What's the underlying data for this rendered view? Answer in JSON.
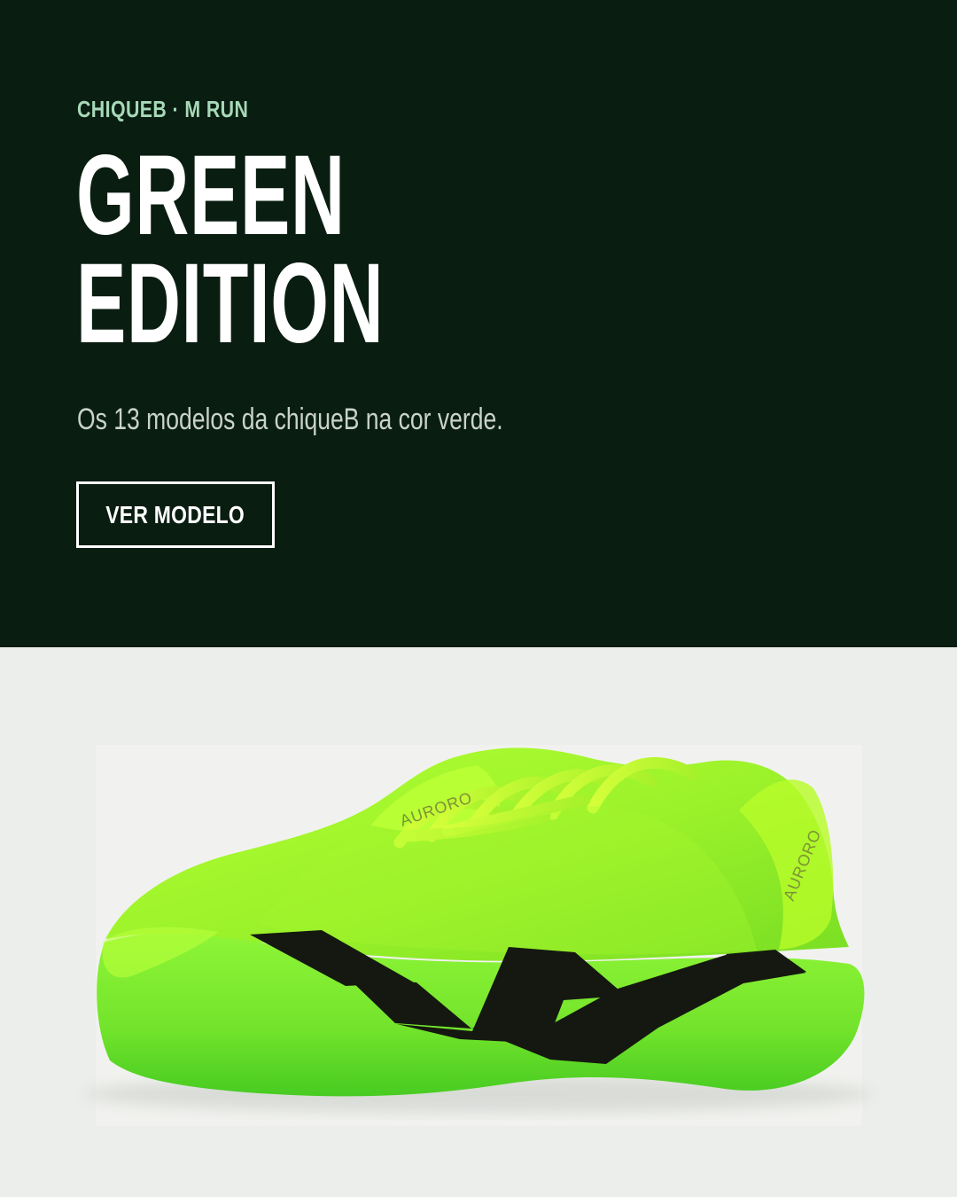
{
  "hero": {
    "eyebrow": "CHIQUEB · M RUN",
    "headline_line1": "GREEN",
    "headline_line2": "EDITION",
    "subtitle": "Os 13 modelos da chiqueB na cor verde.",
    "cta_label": "VER MODELO"
  },
  "product": {
    "brand_text": "AURORO",
    "tongue_text": "AURORO"
  },
  "colors": {
    "hero_background": "#091d11",
    "eyebrow": "#a7d9b8",
    "headline": "#ffffff",
    "subtitle": "#c9d2cb",
    "product_background": "#eceeeb",
    "shoe_upper": "#9ff22c",
    "shoe_midsole": "#8ceb32",
    "stripe": "#151811"
  }
}
